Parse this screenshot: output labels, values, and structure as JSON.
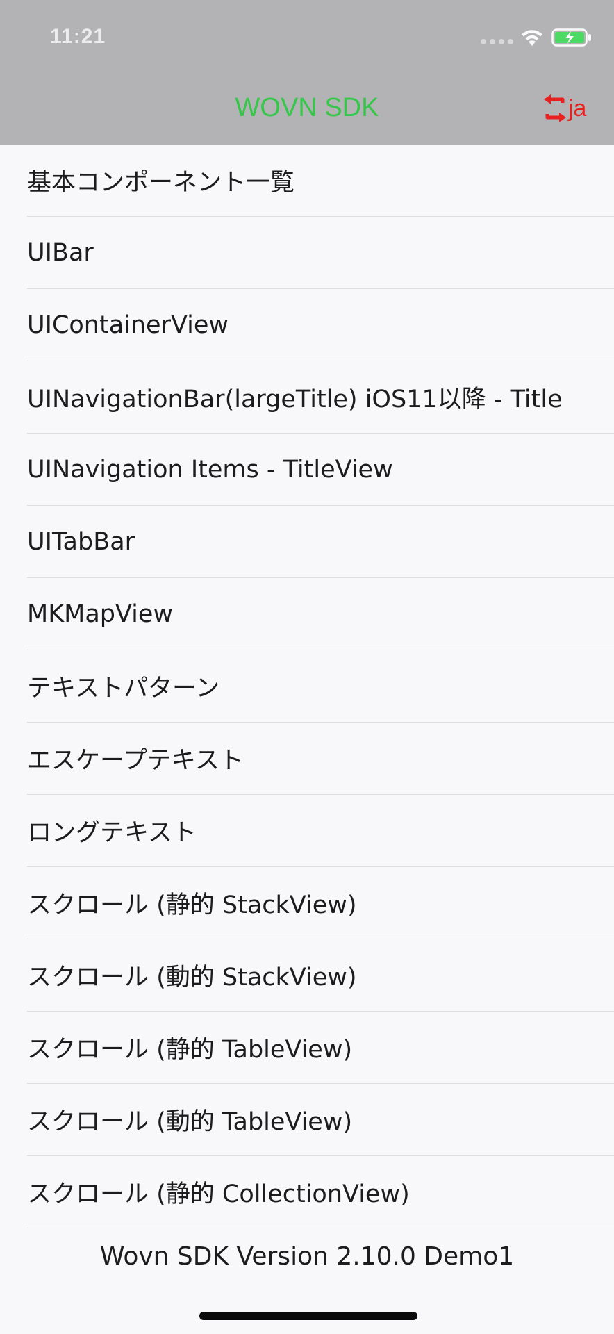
{
  "status": {
    "time": "11:21"
  },
  "nav": {
    "title": "WOVN SDK",
    "language": "ja"
  },
  "colors": {
    "title": "#35c64a",
    "language": "#e8211f",
    "bar": "#b3b3b6"
  },
  "icons": {
    "language_switch": "arrows-swap-icon",
    "wifi": "wifi-icon",
    "battery": "battery-charging-icon"
  },
  "menu": [
    {
      "label": "基本コンポーネント一覧"
    },
    {
      "label": "UIBar"
    },
    {
      "label": "UIContainerView"
    },
    {
      "label": "UINavigationBar(largeTitle) iOS11以降 - Title"
    },
    {
      "label": "UINavigation Items - TitleView"
    },
    {
      "label": "UITabBar"
    },
    {
      "label": "MKMapView"
    },
    {
      "label": "テキストパターン"
    },
    {
      "label": "エスケープテキスト"
    },
    {
      "label": "ロングテキスト"
    },
    {
      "label": "スクロール (静的 StackView)"
    },
    {
      "label": "スクロール (動的 StackView)"
    },
    {
      "label": "スクロール (静的 TableView)"
    },
    {
      "label": "スクロール (動的 TableView)"
    },
    {
      "label": "スクロール (静的 CollectionView)"
    }
  ],
  "footer": {
    "version": "Wovn SDK Version 2.10.0 Demo1"
  }
}
